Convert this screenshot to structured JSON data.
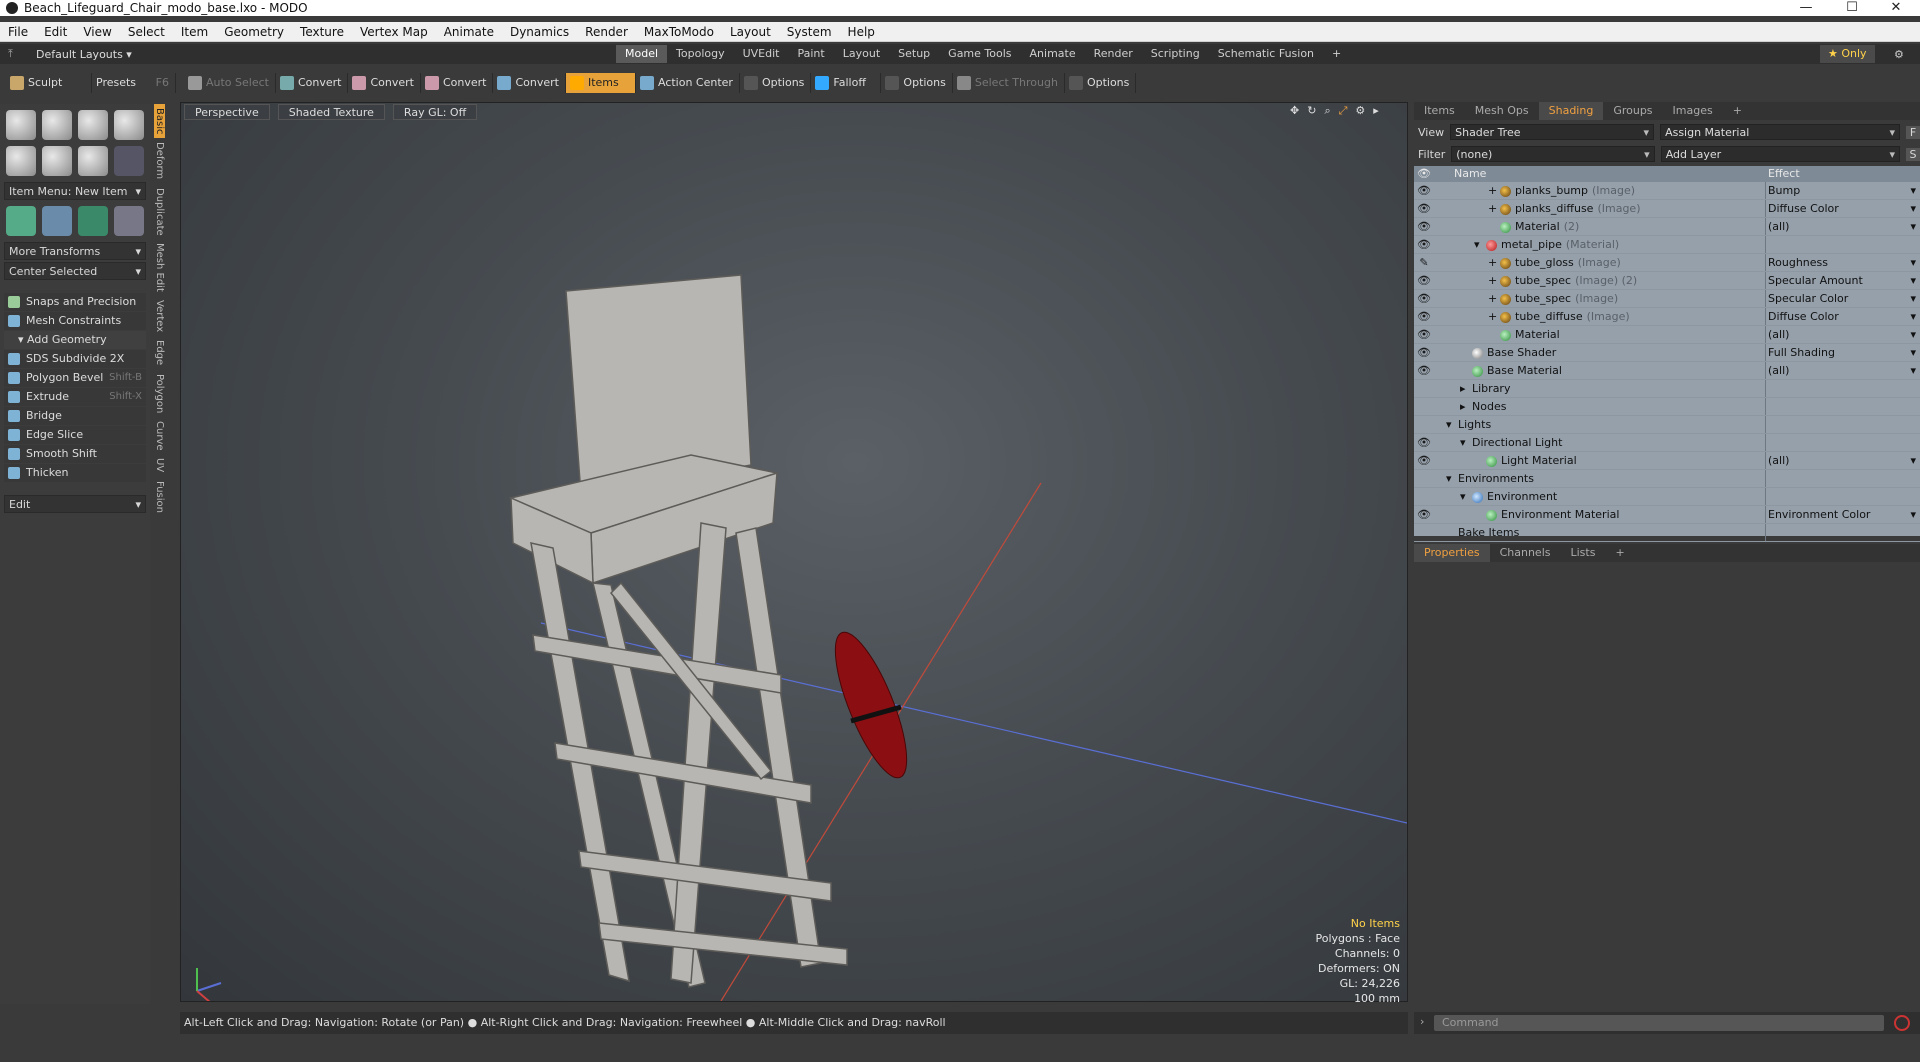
{
  "window": {
    "title": "Beach_Lifeguard_Chair_modo_base.lxo - MODO",
    "controls": [
      "—",
      "☐",
      "✕"
    ]
  },
  "menu": [
    "File",
    "Edit",
    "View",
    "Select",
    "Item",
    "Geometry",
    "Texture",
    "Vertex Map",
    "Animate",
    "Dynamics",
    "Render",
    "MaxToModo",
    "Layout",
    "System",
    "Help"
  ],
  "layoutbar": {
    "layouts_label": "Default Layouts ▾",
    "tabs": [
      "Model",
      "Topology",
      "UVEdit",
      "Paint",
      "Layout",
      "Setup",
      "Game Tools",
      "Animate",
      "Render",
      "Scripting",
      "Schematic Fusion",
      "+"
    ],
    "active": "Model",
    "only": "★ Only"
  },
  "toolbar": {
    "sculpt": "Sculpt",
    "presets": "Presets",
    "presets_key": "F6",
    "items": [
      {
        "label": "Auto Select",
        "state": "dim"
      },
      {
        "label": "Convert",
        "state": "normal"
      },
      {
        "label": "Convert",
        "state": "normal"
      },
      {
        "label": "Convert",
        "state": "normal"
      },
      {
        "label": "Convert",
        "state": "normal"
      },
      {
        "label": "Items",
        "state": "active"
      },
      {
        "label": "Action Center",
        "state": "normal"
      },
      {
        "label": "Options",
        "state": "normal"
      },
      {
        "label": "Falloff",
        "state": "normal"
      },
      {
        "label": "Options",
        "state": "normal"
      },
      {
        "label": "Select Through",
        "state": "dim"
      },
      {
        "label": "Options",
        "state": "normal"
      }
    ]
  },
  "left": {
    "item_menu": "Item Menu: New Item",
    "more_transforms": "More Transforms",
    "center_selected": "Center Selected",
    "snaps": "Snaps and Precision",
    "mesh_constraints": "Mesh Constraints",
    "add_geometry": "Add Geometry",
    "tools": [
      {
        "label": "SDS Subdivide 2X",
        "key": ""
      },
      {
        "label": "Polygon Bevel",
        "key": "Shift-B"
      },
      {
        "label": "Extrude",
        "key": "Shift-X"
      },
      {
        "label": "Bridge",
        "key": ""
      },
      {
        "label": "Edge Slice",
        "key": ""
      },
      {
        "label": "Smooth Shift",
        "key": ""
      },
      {
        "label": "Thicken",
        "key": ""
      }
    ],
    "edit": "Edit",
    "vtabs": [
      "Basic",
      "Deform",
      "Duplicate",
      "Mesh Edit",
      "Vertex",
      "Edge",
      "Polygon",
      "Curve",
      "UV",
      "Fusion"
    ]
  },
  "viewport": {
    "chips": [
      "Perspective",
      "Shaded Texture",
      "Ray GL: Off"
    ],
    "info": {
      "no_items": "No Items",
      "polygons": "Polygons : Face",
      "channels": "Channels: 0",
      "deformers": "Deformers: ON",
      "gl": "GL: 24,226",
      "scale": "100 mm"
    }
  },
  "status": "Alt-Left Click and Drag: Navigation: Rotate (or Pan) ● Alt-Right Click and Drag: Navigation: Freewheel ● Alt-Middle Click and Drag: navRoll",
  "right": {
    "tabs": [
      "Items",
      "Mesh Ops",
      "Shading",
      "Groups",
      "Images",
      "+"
    ],
    "active_tab": "Shading",
    "view_label": "View",
    "view_value": "Shader Tree",
    "assign": "Assign Material",
    "filter_label": "Filter",
    "filter_value": "(none)",
    "add_layer": "Add Layer",
    "col_name": "Name",
    "col_effect": "Effect",
    "rows": [
      {
        "indent": 3,
        "exp": "+",
        "dot": "img",
        "name": "planks_bump",
        "sub": "(Image)",
        "effect": "Bump",
        "eye": "👁"
      },
      {
        "indent": 3,
        "exp": "+",
        "dot": "img",
        "name": "planks_diffuse",
        "sub": "(Image)",
        "effect": "Diffuse Color",
        "eye": "👁"
      },
      {
        "indent": 3,
        "exp": "",
        "dot": "mat",
        "name": "Material",
        "sub": "(2)",
        "effect": "(all)",
        "eye": "👁"
      },
      {
        "indent": 2,
        "exp": "▾",
        "dot": "red",
        "name": "metal_pipe",
        "sub": "(Material)",
        "effect": "",
        "eye": "👁"
      },
      {
        "indent": 3,
        "exp": "+",
        "dot": "img",
        "name": "tube_gloss",
        "sub": "(Image)",
        "effect": "Roughness",
        "eye": "✎"
      },
      {
        "indent": 3,
        "exp": "+",
        "dot": "img",
        "name": "tube_spec",
        "sub": "(Image) (2)",
        "effect": "Specular Amount",
        "eye": "👁"
      },
      {
        "indent": 3,
        "exp": "+",
        "dot": "img",
        "name": "tube_spec",
        "sub": "(Image)",
        "effect": "Specular Color",
        "eye": "👁"
      },
      {
        "indent": 3,
        "exp": "+",
        "dot": "img",
        "name": "tube_diffuse",
        "sub": "(Image)",
        "effect": "Diffuse Color",
        "eye": "👁"
      },
      {
        "indent": 3,
        "exp": "",
        "dot": "mat",
        "name": "Material",
        "sub": "",
        "effect": "(all)",
        "eye": "👁"
      },
      {
        "indent": 1,
        "exp": "",
        "dot": "gray",
        "name": "Base Shader",
        "sub": "",
        "effect": "Full Shading",
        "eye": "👁"
      },
      {
        "indent": 1,
        "exp": "",
        "dot": "mat",
        "name": "Base Material",
        "sub": "",
        "effect": "(all)",
        "eye": "👁"
      },
      {
        "indent": 1,
        "exp": "▸",
        "dot": "",
        "name": "Library",
        "sub": "",
        "effect": "",
        "eye": ""
      },
      {
        "indent": 1,
        "exp": "▸",
        "dot": "",
        "name": "Nodes",
        "sub": "",
        "effect": "",
        "eye": ""
      },
      {
        "indent": 0,
        "exp": "▾",
        "dot": "",
        "name": "Lights",
        "sub": "",
        "effect": "",
        "eye": ""
      },
      {
        "indent": 1,
        "exp": "▾",
        "dot": "",
        "name": "Directional Light",
        "sub": "",
        "effect": "",
        "eye": "👁"
      },
      {
        "indent": 2,
        "exp": "",
        "dot": "mat",
        "name": "Light Material",
        "sub": "",
        "effect": "(all)",
        "eye": "👁"
      },
      {
        "indent": 0,
        "exp": "▾",
        "dot": "",
        "name": "Environments",
        "sub": "",
        "effect": "",
        "eye": ""
      },
      {
        "indent": 1,
        "exp": "▾",
        "dot": "blue",
        "name": "Environment",
        "sub": "",
        "effect": "",
        "eye": ""
      },
      {
        "indent": 2,
        "exp": "",
        "dot": "mat",
        "name": "Environment Material",
        "sub": "",
        "effect": "Environment Color",
        "eye": "👁"
      },
      {
        "indent": 0,
        "exp": "",
        "dot": "",
        "name": "Bake Items",
        "sub": "",
        "effect": "",
        "eye": ""
      }
    ],
    "prop_tabs": [
      "Properties",
      "Channels",
      "Lists",
      "+"
    ],
    "active_prop": "Properties",
    "command_placeholder": "Command"
  }
}
